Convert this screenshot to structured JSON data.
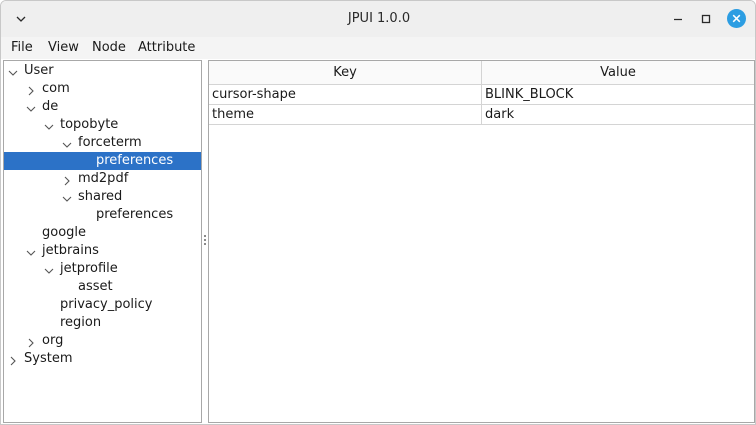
{
  "window": {
    "title": "JPUI 1.0.0",
    "accent_color": "#2c9de2"
  },
  "menubar": {
    "items": [
      {
        "label": "File"
      },
      {
        "label": "View"
      },
      {
        "label": "Node"
      },
      {
        "label": "Attribute"
      }
    ]
  },
  "tree": {
    "selected_color": "#2c72c7",
    "nodes": [
      {
        "label": "User",
        "depth": 0,
        "toggle": "expanded"
      },
      {
        "label": "com",
        "depth": 1,
        "toggle": "collapsed"
      },
      {
        "label": "de",
        "depth": 1,
        "toggle": "expanded"
      },
      {
        "label": "topobyte",
        "depth": 2,
        "toggle": "expanded"
      },
      {
        "label": "forceterm",
        "depth": 3,
        "toggle": "expanded"
      },
      {
        "label": "preferences",
        "depth": 4,
        "toggle": "none",
        "selected": true
      },
      {
        "label": "md2pdf",
        "depth": 3,
        "toggle": "collapsed"
      },
      {
        "label": "shared",
        "depth": 3,
        "toggle": "expanded"
      },
      {
        "label": "preferences",
        "depth": 4,
        "toggle": "none"
      },
      {
        "label": "google",
        "depth": 1,
        "toggle": "none"
      },
      {
        "label": "jetbrains",
        "depth": 1,
        "toggle": "expanded"
      },
      {
        "label": "jetprofile",
        "depth": 2,
        "toggle": "expanded"
      },
      {
        "label": "asset",
        "depth": 3,
        "toggle": "none"
      },
      {
        "label": "privacy_policy",
        "depth": 2,
        "toggle": "none"
      },
      {
        "label": "region",
        "depth": 2,
        "toggle": "none"
      },
      {
        "label": "org",
        "depth": 1,
        "toggle": "collapsed"
      },
      {
        "label": "System",
        "depth": 0,
        "toggle": "collapsed"
      }
    ]
  },
  "table": {
    "columns": [
      "Key",
      "Value"
    ],
    "rows": [
      {
        "key": "cursor-shape",
        "value": "BLINK_BLOCK"
      },
      {
        "key": "theme",
        "value": "dark"
      }
    ]
  }
}
